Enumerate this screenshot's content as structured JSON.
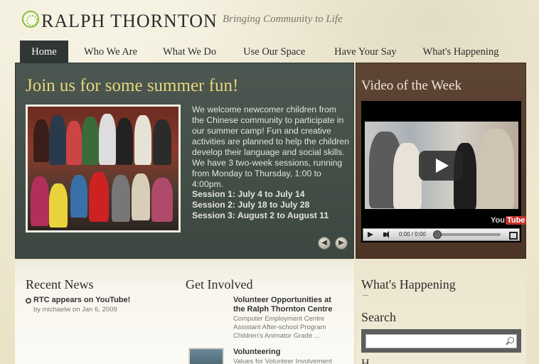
{
  "header": {
    "logo_text": "RALPH THORNTON",
    "tagline": "Bringing Community to Life"
  },
  "nav": {
    "items": [
      {
        "label": "Home",
        "active": true
      },
      {
        "label": "Who We Are"
      },
      {
        "label": "What We Do"
      },
      {
        "label": "Use Our Space"
      },
      {
        "label": "Have Your Say"
      },
      {
        "label": "What's Happening"
      }
    ]
  },
  "feature": {
    "title": "Join us for some summer fun!",
    "body": "We welcome newcomer children from the Chinese community to participate in our summer camp! Fun and creative activities are planned to help the children develop their language and social skills. We have 3 two-week sessions, running from Monday to Thursday, 1:00 to 4:00pm.",
    "sessions": [
      "Session 1: July 4 to July 14",
      "Session 2: July 18 to July 28",
      "Session 3: August 2 to August 11"
    ],
    "prev_icon": "◀",
    "next_icon": "▶"
  },
  "video": {
    "title": "Video of the Week",
    "time": "0:00 / 0:00",
    "brand_prefix": "You",
    "brand_suffix": "Tube"
  },
  "recent_news": {
    "title": "Recent News",
    "items": [
      {
        "title": "RTC appears on YouTube!",
        "meta": "by michaelw on Jan 6, 2009"
      }
    ]
  },
  "get_involved": {
    "title": "Get Involved",
    "items": [
      {
        "title_line1": "Volunteer Opportunities at",
        "title_line2": "the Ralph Thornton Centre",
        "desc_lines": [
          "Computer Employment Centre",
          "Assistant After-school Program",
          "Children's Animator Grade ..."
        ]
      },
      {
        "title_line1": "Volunteering",
        "desc_lines": [
          "Values for Volunteer Involvement"
        ]
      }
    ]
  },
  "sidebar": {
    "whats_happening_title": "What's Happening",
    "search_title": "Search",
    "search_value": "",
    "next_heading_fragment": "H"
  }
}
